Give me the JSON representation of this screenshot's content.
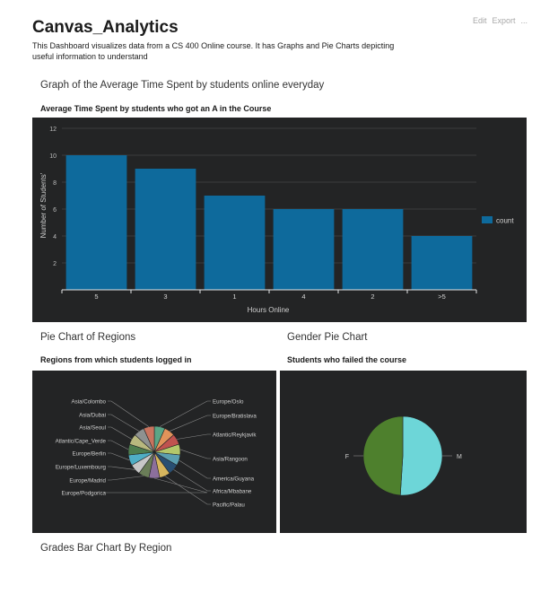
{
  "header": {
    "title": "Canvas_Analytics",
    "description": "This Dashboard visualizes data from a CS 400 Online course. It has Graphs and Pie Charts depicting useful information to understand",
    "menu": {
      "edit": "Edit",
      "export": "Export",
      "more": "..."
    }
  },
  "panels": {
    "time_panel_title": "Graph of the Average Time Spent by students online everyday",
    "regions_panel_title": "Pie Chart of Regions",
    "gender_panel_title": "Gender Pie Chart",
    "grades_panel_title": "Grades Bar Chart By Region"
  },
  "chart_data": [
    {
      "type": "bar",
      "title": "Average Time Spent by students who got an A in the Course",
      "xlabel": "Hours Online",
      "ylabel": "Number of Students'",
      "categories": [
        "5",
        "3",
        "1",
        "4",
        "2",
        ">5"
      ],
      "series": [
        {
          "name": "count",
          "values": [
            10,
            9,
            7,
            6,
            6,
            4
          ]
        }
      ],
      "ylim": [
        0,
        12
      ],
      "yticks": [
        2,
        4,
        6,
        8,
        10,
        12
      ],
      "grid": true,
      "legend": "right",
      "color": "#0e6a9c"
    },
    {
      "type": "pie",
      "title": "Regions from which students logged in",
      "labels": [
        "Europe/Oslo",
        "Europe/Bratislava",
        "Atlantic/Reykjavik",
        "Asia/Rangoon",
        "America/Guyana",
        "Africa/Mbabane",
        "Pacific/Palau",
        "Europe/Podgorica",
        "Europe/Madrid",
        "Europe/Luxembourg",
        "Europe/Berlin",
        "Atlantic/Cape_Verde",
        "Asia/Seoul",
        "Asia/Dubai",
        "Asia/Colombo"
      ],
      "values": [
        1,
        1,
        1,
        1,
        1,
        1,
        1,
        1,
        1,
        1,
        1,
        1,
        1,
        1,
        1
      ],
      "colors": [
        "#5aa586",
        "#e2935a",
        "#c0524f",
        "#b3c76a",
        "#5b9fb0",
        "#294f72",
        "#d7b65e",
        "#8c6f9c",
        "#6a7d58",
        "#c7c7c7",
        "#4faec5",
        "#4e7d4e",
        "#b8b87e",
        "#8e9190",
        "#c9745f"
      ],
      "legend": "none"
    },
    {
      "type": "pie",
      "title": "Students who failed the course",
      "labels": [
        "M",
        "F"
      ],
      "values": [
        51,
        49
      ],
      "colors": [
        "#6dd6d8",
        "#4e802d"
      ],
      "legend": "none"
    }
  ]
}
